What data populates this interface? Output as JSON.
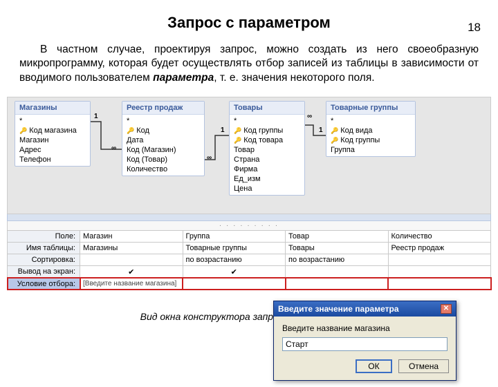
{
  "page_number": "18",
  "title": "Запрос с параметром",
  "paragraph": "В частном случае, проектируя запрос, можно создать из него своеобразную микропрограмму, которая будет осуществлять отбор записей из таблицы в зависимости от вводимого пользователем ",
  "param_word": "параметра",
  "paragraph_tail": ", т. е. значения некоторого поля.",
  "tables": {
    "shops": {
      "title": "Магазины",
      "fields": [
        "*",
        "Код магазина",
        "Магазин",
        "Адрес",
        "Телефон"
      ]
    },
    "sales": {
      "title": "Реестр продаж",
      "fields": [
        "*",
        "Код",
        "Дата",
        "Код (Магазин)",
        "Код (Товар)",
        "Количество"
      ]
    },
    "goods": {
      "title": "Товары",
      "fields": [
        "*",
        "Код группы",
        "Код товара",
        "Товар",
        "Страна",
        "Фирма",
        "Ед_изм",
        "Цена"
      ]
    },
    "groups": {
      "title": "Товарные группы",
      "fields": [
        "*",
        "Код вида",
        "Код группы",
        "Группа"
      ]
    }
  },
  "rel": {
    "one": "1",
    "many": "∞"
  },
  "grid": {
    "labels": {
      "field": "Поле:",
      "table": "Имя таблицы:",
      "sort": "Сортировка:",
      "show": "Вывод на экран:",
      "criteria": "Условие отбора:"
    },
    "cols": [
      {
        "field": "Магазин",
        "table": "Магазины",
        "sort": "",
        "show": true,
        "criteria": "[Введите название магазина]"
      },
      {
        "field": "Группа",
        "table": "Товарные группы",
        "sort": "по возрастанию",
        "show": true,
        "criteria": ""
      },
      {
        "field": "Товар",
        "table": "Товары",
        "sort": "по возрастанию",
        "show": false,
        "criteria": ""
      },
      {
        "field": "Количество",
        "table": "Реестр продаж",
        "sort": "",
        "show": false,
        "criteria": ""
      }
    ]
  },
  "dialog": {
    "title": "Введите значение параметра",
    "label": "Введите название магазина",
    "value": "Старт",
    "ok": "ОК",
    "cancel": "Отмена",
    "close": "✕"
  },
  "caption": "Вид окна конструктора запроса с параметром"
}
